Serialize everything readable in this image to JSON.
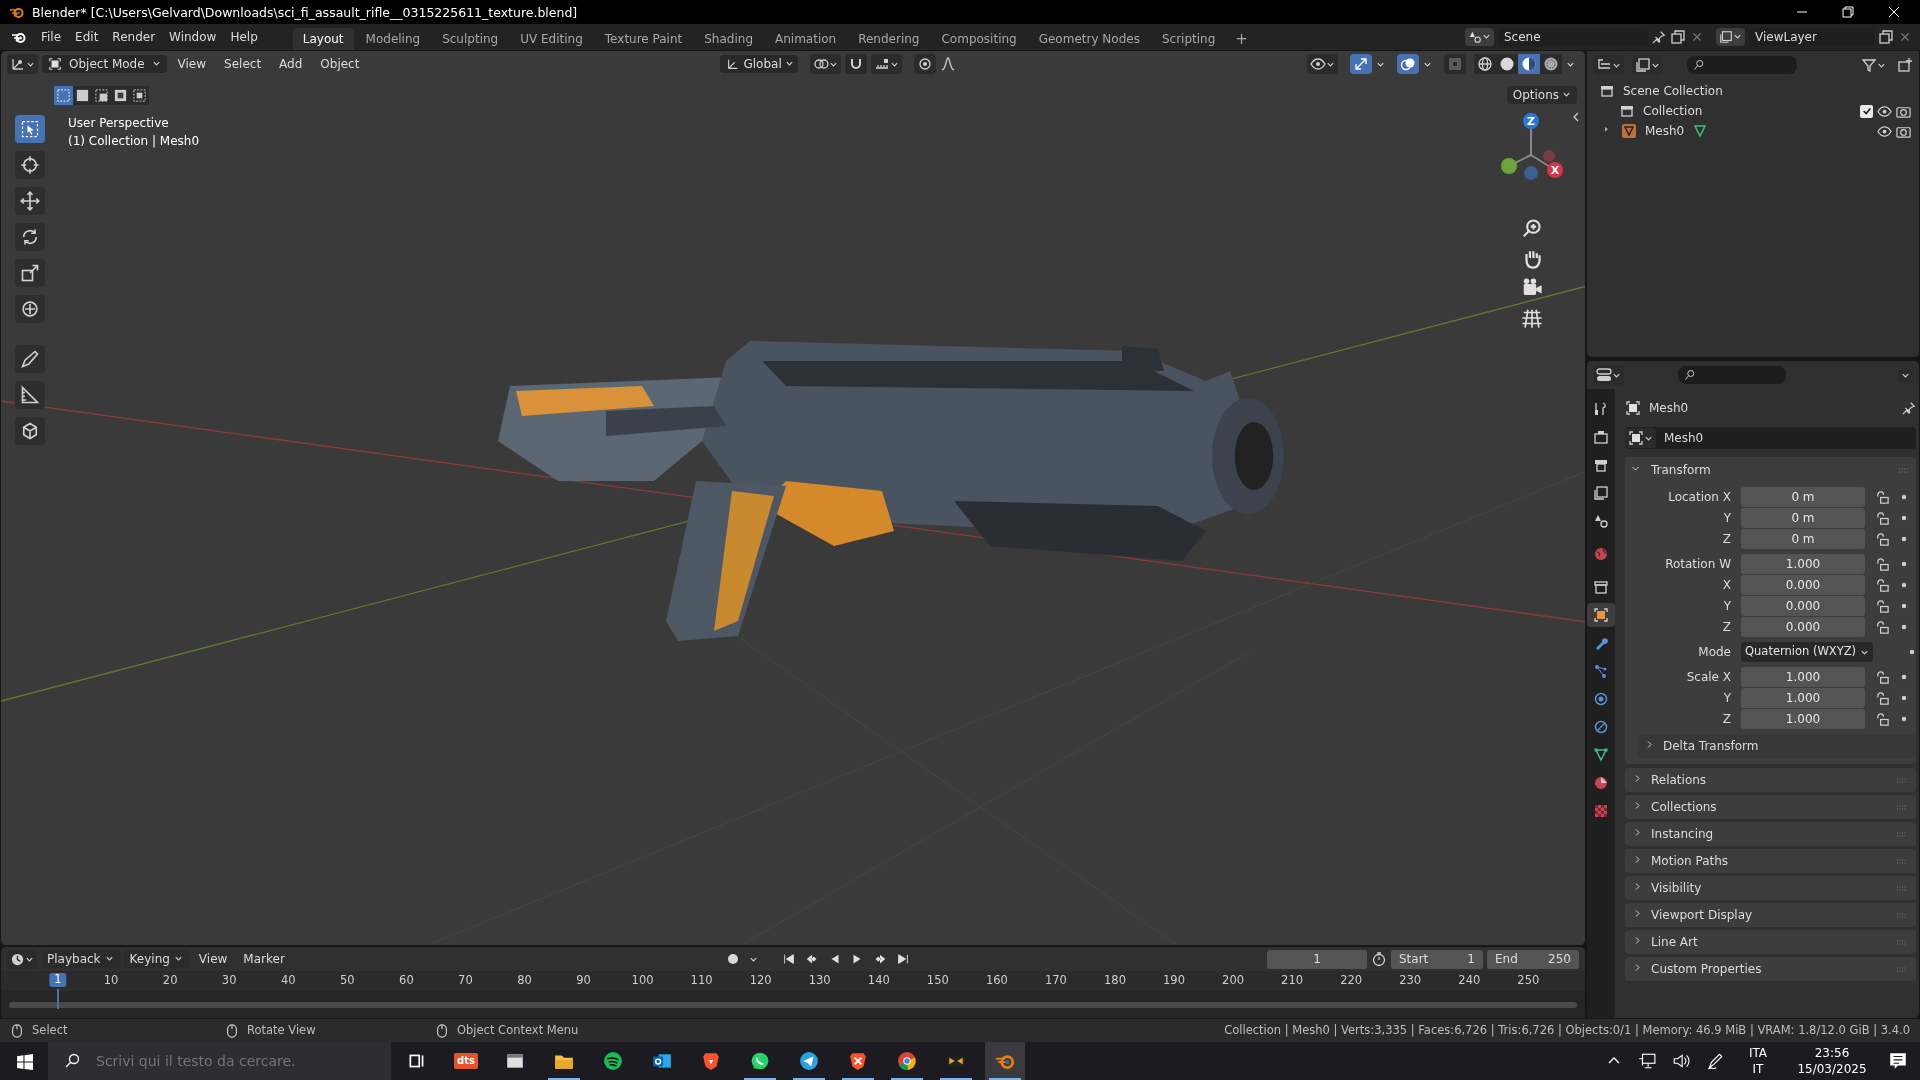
{
  "window": {
    "title": "Blender* [C:\\Users\\Gelvard\\Downloads\\sci_fi_assault_rifle__0315225611_texture.blend]"
  },
  "menus": [
    "File",
    "Edit",
    "Render",
    "Window",
    "Help"
  ],
  "workspaces": [
    {
      "label": "Layout",
      "selected": true
    },
    {
      "label": "Modeling",
      "selected": false
    },
    {
      "label": "Sculpting",
      "selected": false
    },
    {
      "label": "UV Editing",
      "selected": false
    },
    {
      "label": "Texture Paint",
      "selected": false
    },
    {
      "label": "Shading",
      "selected": false
    },
    {
      "label": "Animation",
      "selected": false
    },
    {
      "label": "Rendering",
      "selected": false
    },
    {
      "label": "Compositing",
      "selected": false
    },
    {
      "label": "Geometry Nodes",
      "selected": false
    },
    {
      "label": "Scripting",
      "selected": false
    }
  ],
  "add_workspace": "+",
  "scene": "Scene",
  "view_layer": "ViewLayer",
  "viewport": {
    "mode": "Object Mode",
    "menus": [
      "View",
      "Select",
      "Add",
      "Object"
    ],
    "orientation": "Global",
    "select_modes": [
      {
        "selected": true
      },
      {
        "selected": false
      },
      {
        "selected": false
      },
      {
        "selected": false
      },
      {
        "selected": false
      }
    ],
    "shading": [
      {
        "selected": false
      },
      {
        "selected": false
      },
      {
        "selected": true
      },
      {
        "selected": false
      }
    ],
    "options": "Options",
    "info": [
      "User Perspective",
      "(1) Collection | Mesh0"
    ],
    "tools": [
      {
        "kind": "select",
        "selected": true
      },
      {
        "kind": "cursor",
        "selected": false
      },
      {
        "kind": "move",
        "selected": false
      },
      {
        "kind": "rotate",
        "selected": false
      },
      {
        "kind": "scale",
        "selected": false
      },
      {
        "kind": "transform",
        "selected": false
      },
      {
        "kind": "annotate",
        "selected": false
      },
      {
        "kind": "measure",
        "selected": false
      },
      {
        "kind": "add-cube",
        "selected": false
      }
    ],
    "gizmo": {
      "z": "Z",
      "x": "X"
    }
  },
  "outliner": {
    "items": [
      {
        "label": "Scene Collection",
        "kind": "scene",
        "children": [
          {
            "label": "Collection",
            "kind": "collection",
            "checked": true
          },
          {
            "label": "Mesh0",
            "kind": "mesh",
            "expanded": false
          }
        ]
      }
    ]
  },
  "properties": {
    "tabs": [
      {
        "kind": "tool",
        "selected": false
      },
      {
        "kind": "render",
        "selected": false
      },
      {
        "kind": "output",
        "selected": false
      },
      {
        "kind": "view-layer",
        "selected": false
      },
      {
        "kind": "scene",
        "selected": false
      },
      {
        "kind": "world",
        "selected": false
      },
      {
        "kind": "collection",
        "selected": false
      },
      {
        "kind": "object",
        "selected": true
      },
      {
        "kind": "modifiers",
        "selected": false
      },
      {
        "kind": "particles",
        "selected": false
      },
      {
        "kind": "physics",
        "selected": false
      },
      {
        "kind": "constraints",
        "selected": false
      },
      {
        "kind": "data",
        "selected": false
      },
      {
        "kind": "material",
        "selected": false
      },
      {
        "kind": "texture",
        "selected": false
      }
    ],
    "object": "Mesh0",
    "datablock": "Mesh0",
    "transform": {
      "title": "Transform",
      "expanded": true,
      "groups": [
        [
          {
            "label": "Location X",
            "value": "0 m",
            "kind": "number"
          },
          {
            "label": "Y",
            "value": "0 m",
            "kind": "number"
          },
          {
            "label": "Z",
            "value": "0 m",
            "kind": "number"
          }
        ],
        [
          {
            "label": "Rotation W",
            "value": "1.000",
            "kind": "number"
          },
          {
            "label": "X",
            "value": "0.000",
            "kind": "number"
          },
          {
            "label": "Y",
            "value": "0.000",
            "kind": "number"
          },
          {
            "label": "Z",
            "value": "0.000",
            "kind": "number"
          }
        ],
        [
          {
            "label": "Mode",
            "value": "Quaternion (WXYZ)",
            "kind": "select"
          }
        ],
        [
          {
            "label": "Scale X",
            "value": "1.000",
            "kind": "number"
          },
          {
            "label": "Y",
            "value": "1.000",
            "kind": "number"
          },
          {
            "label": "Z",
            "value": "1.000",
            "kind": "number"
          }
        ]
      ],
      "subpanels": [
        {
          "label": "Delta Transform",
          "expanded": false
        }
      ]
    },
    "panels": [
      {
        "label": "Relations",
        "expanded": false
      },
      {
        "label": "Collections",
        "expanded": false
      },
      {
        "label": "Instancing",
        "expanded": false
      },
      {
        "label": "Motion Paths",
        "expanded": false
      },
      {
        "label": "Visibility",
        "expanded": false
      },
      {
        "label": "Viewport Display",
        "expanded": false
      },
      {
        "label": "Line Art",
        "expanded": false
      },
      {
        "label": "Custom Properties",
        "expanded": false
      }
    ]
  },
  "timeline": {
    "menus": [
      "Playback",
      "Keying",
      "View",
      "Marker"
    ],
    "frame": "1",
    "start_label": "Start",
    "start": "1",
    "end_label": "End",
    "end": "250",
    "playhead": "1",
    "ticks": [
      "10",
      "20",
      "30",
      "40",
      "50",
      "60",
      "70",
      "80",
      "90",
      "100",
      "110",
      "120",
      "130",
      "140",
      "150",
      "160",
      "170",
      "180",
      "190",
      "200",
      "210",
      "220",
      "230",
      "240",
      "250"
    ]
  },
  "status_bar": {
    "hints": [
      "Select",
      "Rotate View",
      "Object Context Menu"
    ],
    "stats": "Collection | Mesh0 | Verts:3,335 | Faces:6,726 | Tris:6,726 | Objects:0/1 | Memory: 46.9 MiB | VRAM: 1.8/12.0 GiB | 3.4.0"
  },
  "taskbar": {
    "search": {
      "placeholder": "Scrivi qui il testo da cercare."
    },
    "apps": [
      {
        "kind": "task-view",
        "running": false,
        "selected": false
      },
      {
        "kind": "dts",
        "label": "dts",
        "running": false,
        "selected": false
      },
      {
        "kind": "window",
        "running": false,
        "selected": false
      },
      {
        "kind": "folder",
        "running": true,
        "selected": false
      },
      {
        "kind": "spotify",
        "running": false,
        "selected": false
      },
      {
        "kind": "outlook",
        "running": false,
        "selected": false
      },
      {
        "kind": "brave",
        "running": false,
        "selected": false
      },
      {
        "kind": "whatsapp",
        "running": true,
        "selected": false
      },
      {
        "kind": "telegram",
        "running": true,
        "selected": false
      },
      {
        "kind": "brave-x",
        "running": true,
        "selected": false
      },
      {
        "kind": "chrome",
        "running": true,
        "selected": false
      },
      {
        "kind": "mosaic",
        "running": true,
        "selected": false
      },
      {
        "kind": "blender",
        "running": true,
        "selected": true
      }
    ],
    "tray": {
      "language": "ITA",
      "layout": "IT",
      "time": "23:56",
      "date": "15/03/2025"
    }
  }
}
